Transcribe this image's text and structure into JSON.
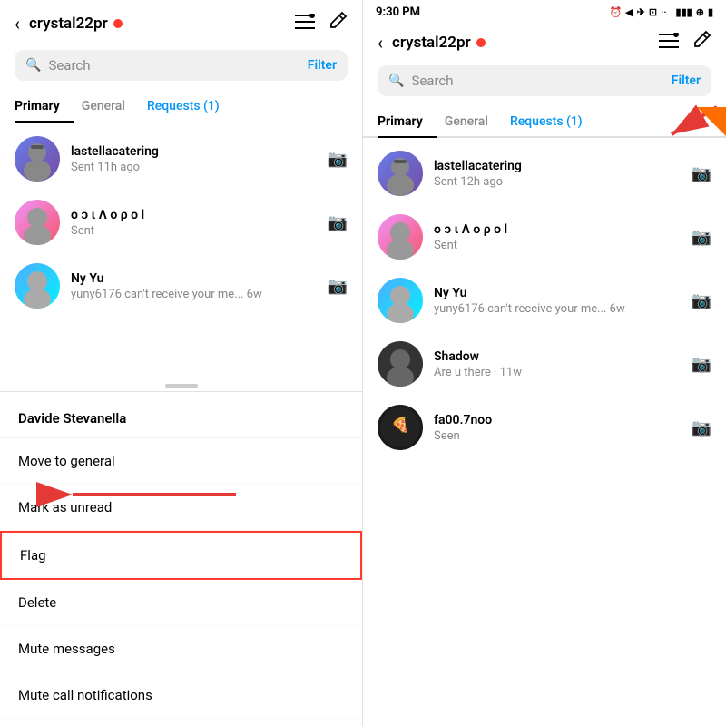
{
  "left": {
    "header": {
      "username": "crystal22pr",
      "back_label": "‹",
      "list_icon": "☰",
      "compose_icon": "✏"
    },
    "search": {
      "placeholder": "Search",
      "filter_label": "Filter"
    },
    "tabs": [
      {
        "label": "Primary",
        "active": true
      },
      {
        "label": "General",
        "active": false
      },
      {
        "label": "Requests (1)",
        "active": false,
        "type": "requests"
      }
    ],
    "messages": [
      {
        "name": "lastellacatering",
        "preview": "Sent 11h ago",
        "avatar_emoji": "🧑"
      },
      {
        "name": "ο ͻ ι Λ ο ρ ο l",
        "preview": "Sent",
        "avatar_emoji": "👤"
      },
      {
        "name": "Ny Yu",
        "preview": "yuny6176 can't receive your me... 6w",
        "avatar_emoji": "👩"
      }
    ],
    "context_menu": {
      "header": "Davide Stevanella",
      "items": [
        "Move to general",
        "Mark as unread",
        "Flag",
        "Delete",
        "Mute messages",
        "Mute call notifications"
      ]
    }
  },
  "right": {
    "status_bar": {
      "time": "9:30 PM",
      "icons": "▲ ◀ ⬛ ··  ▮▮ ▮▮ ⊕ 🔋"
    },
    "header": {
      "username": "crystal22pr",
      "back_label": "‹",
      "list_icon": "☰",
      "compose_icon": "✏"
    },
    "search": {
      "placeholder": "Search",
      "filter_label": "Filter"
    },
    "tabs": [
      {
        "label": "Primary",
        "active": true
      },
      {
        "label": "General",
        "active": false
      },
      {
        "label": "Requests (1)",
        "active": false,
        "type": "requests"
      }
    ],
    "messages": [
      {
        "name": "lastellacatering",
        "preview": "Sent 12h ago",
        "avatar_emoji": "🧑"
      },
      {
        "name": "ο ͻ ι Λ ο ρ ο l",
        "preview": "Sent",
        "avatar_emoji": "👤"
      },
      {
        "name": "Ny Yu",
        "preview": "yuny6176 can't receive your me... 6w",
        "avatar_emoji": "👩"
      },
      {
        "name": "Shadow",
        "preview": "Are u there · 11w",
        "avatar_emoji": "🧑‍🦱"
      },
      {
        "name": "fa00.7noo",
        "preview": "Seen",
        "avatar_emoji": "🍕"
      }
    ]
  },
  "annotations": {
    "red_arrow_left_label": "← pointing to Flag",
    "red_arrow_right_label": "→ pointing to Requests"
  }
}
